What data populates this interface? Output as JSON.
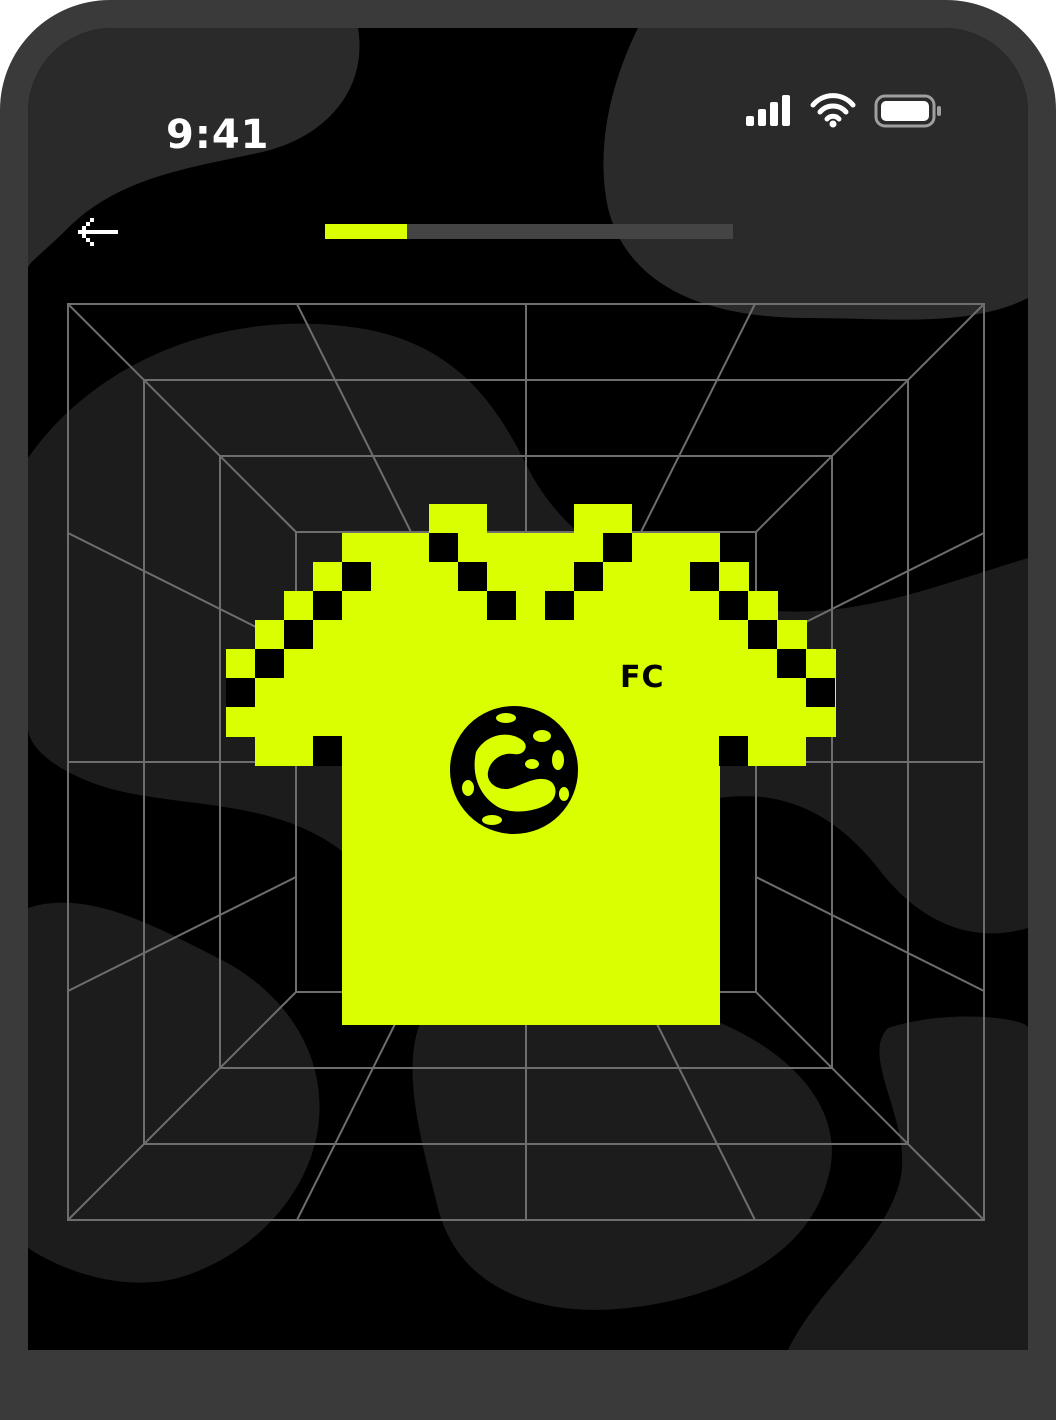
{
  "status_bar": {
    "time": "9:41",
    "signal_icon": "cellular-signal-icon",
    "wifi_icon": "wifi-icon",
    "battery_icon": "battery-icon"
  },
  "nav": {
    "back_icon": "arrow-left-icon"
  },
  "progress": {
    "value_percent": 20
  },
  "jersey": {
    "badge_text": "FC",
    "crest_icon": "football-crest-icon",
    "color": "#d9ff00"
  },
  "colors": {
    "accent": "#d9ff00",
    "background": "#000000",
    "grid_lines": "#6e6e6e",
    "track": "#444444"
  }
}
